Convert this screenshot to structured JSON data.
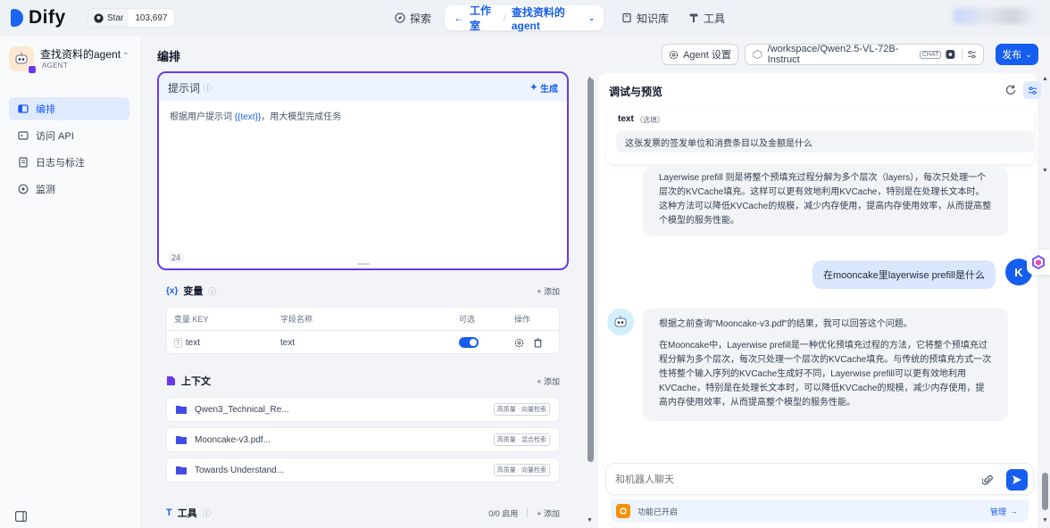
{
  "topbar": {
    "logo_text": "Dify",
    "github": {
      "star_label": "Star",
      "count": "103,697"
    },
    "nav": {
      "explore": "探索",
      "studio": "工作室",
      "current_app": "查找资料的agent",
      "knowledge": "知识库",
      "tools": "工具"
    }
  },
  "sidebar": {
    "app_name": "查找资料的agent",
    "app_type": "AGENT",
    "items": [
      {
        "label": "编排",
        "icon": "orchestrate-icon",
        "active": true
      },
      {
        "label": "访问 API",
        "icon": "api-icon",
        "active": false
      },
      {
        "label": "日志与标注",
        "icon": "logs-icon",
        "active": false
      },
      {
        "label": "监测",
        "icon": "monitor-icon",
        "active": false
      }
    ]
  },
  "header": {
    "title": "编排",
    "agent_settings": "Agent 设置",
    "model": "/workspace/Qwen2.5-VL-72B-Instruct",
    "model_tag": "CHAT",
    "publish": "发布"
  },
  "prompt": {
    "title": "提示词",
    "generate": "生成",
    "text_before": "根据用户提示词 ",
    "variable": "{{text}}",
    "text_after": "，用大模型完成任务",
    "count": "24"
  },
  "variables": {
    "title": "变量",
    "add": "添加",
    "headers": {
      "key": "变量 KEY",
      "name": "字段名称",
      "optional": "可选",
      "action": "操作"
    },
    "rows": [
      {
        "key": "text",
        "name": "text",
        "optional": true
      }
    ]
  },
  "context": {
    "title": "上下文",
    "add": "添加",
    "items": [
      {
        "name": "Qwen3_Technical_Re...",
        "tag": "高质量 · 向量检索"
      },
      {
        "name": "Mooncake-v3.pdf...",
        "tag": "高质量 · 混合检索"
      },
      {
        "name": "Towards Understand...",
        "tag": "高质量 · 向量检索"
      }
    ]
  },
  "tools": {
    "title": "工具",
    "enabled": "0/0 启用",
    "add": "添加"
  },
  "debug": {
    "title": "调试与预览",
    "var_name": "text",
    "var_optional": "（选填）",
    "var_value": "这张发票的签发单位和消费条目以及金额是什么",
    "bot_msg_1": "Layerwise prefill 则是将整个预填充过程分解为多个层次（layers），每次只处理一个层次的KVCache填充。这样可以更有效地利用KVCache，特别是在处理长文本时。这种方法可以降低KVCache的规模，减少内存使用，提高内存使用效率，从而提高整个模型的服务性能。",
    "user_msg": "在mooncake里layerwise prefill是什么",
    "user_initial": "K",
    "bot_msg_2_intro": "根据之前查询\"Mooncake-v3.pdf\"的结果，我可以回答这个问题。",
    "bot_msg_2_body": "在Mooncake中，Layerwise prefill是一种优化预填充过程的方法，它将整个预填充过程分解为多个层次，每次只处理一个层次的KVCache填充。与传统的预填充方式一次性将整个输入序列的KVCache生成好不同，Layerwise prefill可以更有效地利用KVCache，特别是在处理长文本时，可以降低KVCache的规模，减少内存使用，提高内存使用效率，从而提高整个模型的服务性能。",
    "input_placeholder": "和机器人聊天",
    "features_enabled": "功能已开启",
    "manage": "管理"
  },
  "colors": {
    "accent": "#155eef",
    "prompt_border": "#6938ef"
  }
}
